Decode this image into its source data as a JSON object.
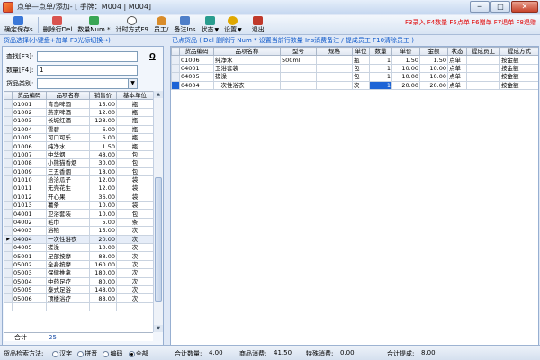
{
  "window": {
    "title": "点单—点单/添加- [ 手牌：M004 | M004]",
    "min": "─",
    "max": "□",
    "close": "✕"
  },
  "toolbar": {
    "buttons": [
      {
        "label": "确定保存s",
        "icon": "save-icon",
        "color": "#3b78d8"
      },
      {
        "label": "删除行Del",
        "icon": "delete-row-icon",
        "color": "#d9534f"
      },
      {
        "label": "数量Num *",
        "icon": "quantity-icon",
        "color": "#3aa655"
      },
      {
        "label": "计时方式F9",
        "icon": "clock-icon",
        "color": "#8a8a8a"
      },
      {
        "label": "员工/",
        "icon": "staff-icon",
        "color": "#d98c2a"
      },
      {
        "label": "备注Ins",
        "icon": "note-icon",
        "color": "#4f7fc9"
      },
      {
        "label": "状态",
        "icon": "status-icon",
        "color": "#2a9d8f"
      },
      {
        "label": "设置",
        "icon": "settings-icon",
        "color": "#e0a800"
      },
      {
        "label": "退出",
        "icon": "exit-icon",
        "color": "#c0392b"
      }
    ],
    "hotkeys": "F3录入  F4数量  F5点单  F6赠单  F7退单  F8退赠"
  },
  "left": {
    "hint": "货品选择(小键盘+加单 F3光标切换→)",
    "search_label": "查找[F3]:",
    "search_value": "",
    "q_label": "Q",
    "qty_label": "数量[F4]:",
    "qty_value": "1",
    "category_label": "货品类别:",
    "category_value": "",
    "columns": [
      "货品编码",
      "品项名称",
      "销售价",
      "基本单位"
    ],
    "rows": [
      [
        "01001",
        "青岛啤酒",
        "15.00",
        "瓶"
      ],
      [
        "01002",
        "燕京啤酒",
        "12.00",
        "瓶"
      ],
      [
        "01003",
        "长城红酒",
        "128.00",
        "瓶"
      ],
      [
        "01004",
        "雪碧",
        "6.00",
        "瓶"
      ],
      [
        "01005",
        "可口可乐",
        "6.00",
        "瓶"
      ],
      [
        "01006",
        "纯净水",
        "1.50",
        "瓶"
      ],
      [
        "01007",
        "中华烟",
        "48.00",
        "包"
      ],
      [
        "01008",
        "小熊猫香烟",
        "30.00",
        "包"
      ],
      [
        "01009",
        "三五香烟",
        "18.00",
        "包"
      ],
      [
        "01010",
        "洽洽瓜子",
        "12.00",
        "袋"
      ],
      [
        "01011",
        "无壳花生",
        "12.00",
        "袋"
      ],
      [
        "01012",
        "开心果",
        "36.00",
        "袋"
      ],
      [
        "01013",
        "薯条",
        "10.00",
        "袋"
      ],
      [
        "04001",
        "卫浴套装",
        "10.00",
        "包"
      ],
      [
        "04002",
        "毛巾",
        "5.00",
        "条"
      ],
      [
        "04003",
        "浴袍",
        "15.00",
        "次"
      ],
      [
        "04004",
        "一次性浴衣",
        "20.00",
        "次"
      ],
      [
        "04005",
        "搓澡",
        "10.00",
        "次"
      ],
      [
        "05001",
        "足部按摩",
        "88.00",
        "次"
      ],
      [
        "05002",
        "全身按摩",
        "160.00",
        "次"
      ],
      [
        "05003",
        "保健推拿",
        "180.00",
        "次"
      ],
      [
        "05004",
        "中药足疗",
        "80.00",
        "次"
      ],
      [
        "05005",
        "泰式足浴",
        "148.00",
        "次"
      ],
      [
        "05006",
        "顶楼浴疗",
        "88.00",
        "次"
      ]
    ],
    "selected_row_marker": "▶",
    "total_label": "合计",
    "total_value": "25"
  },
  "right": {
    "hint": "已点货品 ( Del 删除行  Num * 设置当前行数量  Ins消费备注  / 提成员工  F10清除员工 )",
    "columns": [
      "货品编码",
      "品项名称",
      "型号",
      "规格",
      "单位",
      "数量",
      "单价",
      "金额",
      "状态",
      "提成员工",
      "提成方式"
    ],
    "rows": [
      [
        "01006",
        "纯净水",
        "500ml",
        "",
        "瓶",
        "1",
        "1.50",
        "1.50",
        "点单",
        "",
        "按金额"
      ],
      [
        "04001",
        "卫浴套装",
        "",
        "",
        "包",
        "1",
        "10.00",
        "10.00",
        "点单",
        "",
        "按金额"
      ],
      [
        "04005",
        "搓澡",
        "",
        "",
        "包",
        "1",
        "10.00",
        "10.00",
        "点单",
        "",
        "按金额"
      ],
      [
        "04004",
        "一次性浴衣",
        "",
        "",
        "次",
        "1",
        "20.00",
        "20.00",
        "点单",
        "",
        "按金额"
      ]
    ]
  },
  "status": {
    "search_method_label": "货品检索方法:",
    "options": [
      "汉字",
      "拼音",
      "编码",
      "全部"
    ],
    "selected_option": "全部",
    "total_qty_label": "合计数量:",
    "total_qty": "4.00",
    "consumption_label": "商品消费:",
    "consumption": "41.50",
    "special_label": "特殊消费:",
    "special": "0.00",
    "commission_label": "合计提成:",
    "commission": "8.00"
  }
}
